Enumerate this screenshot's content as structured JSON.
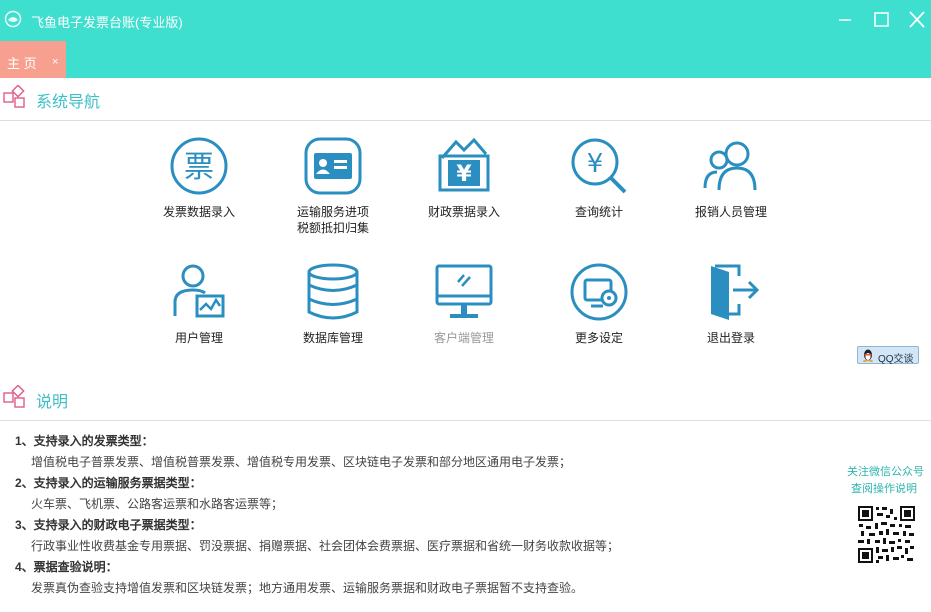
{
  "window": {
    "title": "飞鱼电子发票台账(专业版)"
  },
  "tabs": [
    {
      "label": "主 页",
      "close": "×"
    }
  ],
  "nav_section": {
    "title": "系统导航"
  },
  "nav_items": [
    {
      "label": "发票数据录入",
      "icon": "invoice-ticket-icon"
    },
    {
      "label": "运输服务进项税额抵扣归集",
      "line1": "运输服务进项",
      "line2": "税额抵扣归集",
      "icon": "id-card-icon"
    },
    {
      "label": "财政票据录入",
      "icon": "yuan-bill-icon"
    },
    {
      "label": "查询统计",
      "icon": "yuan-search-icon"
    },
    {
      "label": "报销人员管理",
      "icon": "people-icon"
    },
    {
      "label": "用户管理",
      "icon": "user-chart-icon"
    },
    {
      "label": "数据库管理",
      "icon": "database-icon"
    },
    {
      "label": "客户端管理",
      "icon": "monitor-icon",
      "disabled": true
    },
    {
      "label": "更多设定",
      "icon": "screen-settings-icon"
    },
    {
      "label": "退出登录",
      "icon": "exit-door-icon"
    }
  ],
  "qq": {
    "label": "QQ交谈"
  },
  "desc_section": {
    "title": "说明"
  },
  "description": [
    {
      "heading": "1、支持录入的发票类型：",
      "body": "增值税电子普票发票、增值税普票发票、增值税专用发票、区块链电子发票和部分地区通用电子发票；"
    },
    {
      "heading": "2、支持录入的运输服务票据类型：",
      "body": "火车票、飞机票、公路客运票和水路客运票等；"
    },
    {
      "heading": "3、支持录入的财政电子票据类型：",
      "body": "行政事业性收费基金专用票据、罚没票据、捐赠票据、社会团体会费票据、医疗票据和省统一财务收款收据等；"
    },
    {
      "heading": "4、票据查验说明：",
      "body": "发票真伪查验支持增值发票和区块链发票；地方通用发票、运输服务票据和财政电子票据暂不支持查验。"
    }
  ],
  "wechat": {
    "line1": "关注微信公众号",
    "line2": "查阅操作说明"
  },
  "colors": {
    "titlebar": "#3fdfd0",
    "tab": "#f8a08f",
    "icon": "#2a8fc0",
    "section_title": "#3fbec8"
  }
}
